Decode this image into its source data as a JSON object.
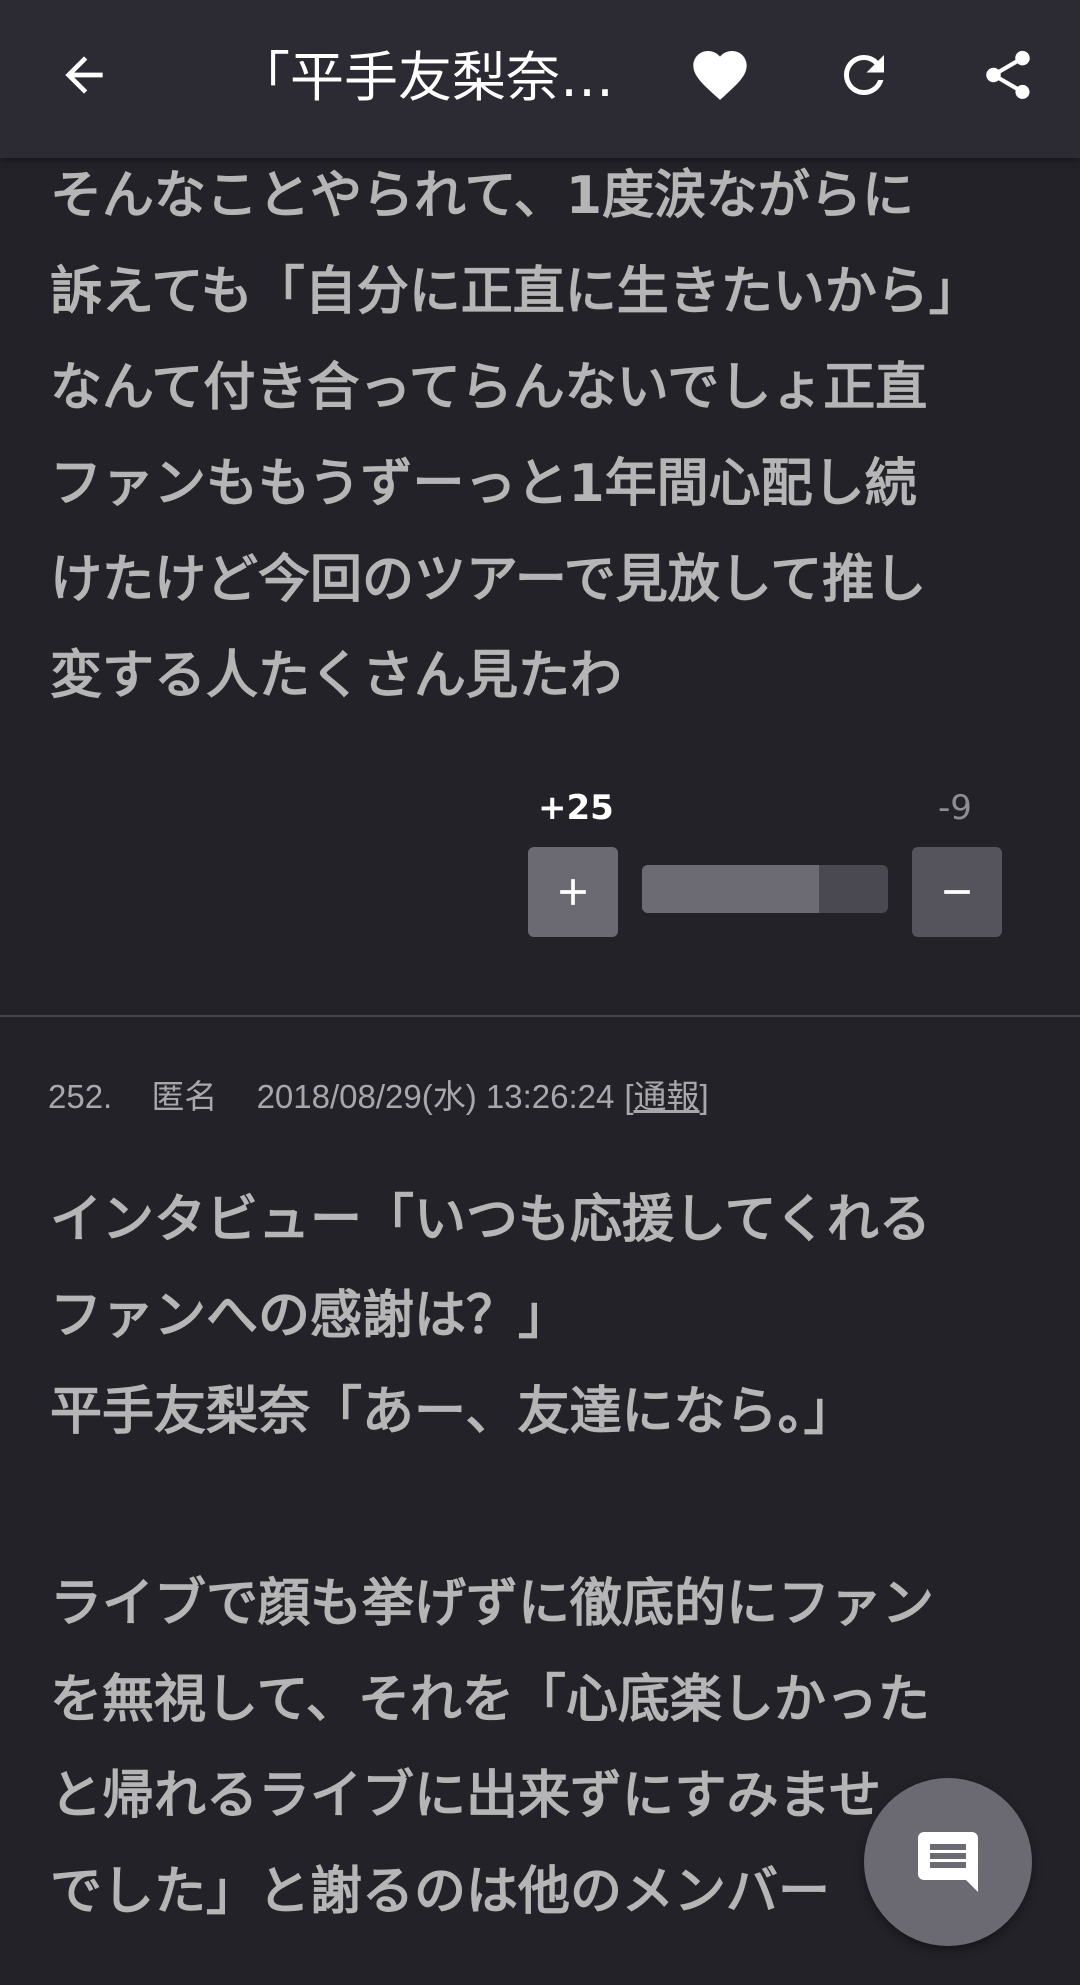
{
  "appbar": {
    "title": "「平手友梨奈…",
    "back_icon": "arrow-left-icon",
    "favorite_icon": "heart-icon",
    "refresh_icon": "refresh-icon",
    "share_icon": "share-icon"
  },
  "comment_prev": {
    "body": "そんなことやられて、1度涙ながらに\n訴えても「自分に正直に生きたいから」\nなんて付き合ってらんないでしょ正直\nファンももうずーっと1年間心配し続\nけたけど今回のツアーで見放して推し\n変する人たくさん見たわ",
    "plus_count": "+25",
    "minus_count": "-9",
    "plus_ratio": 0.72
  },
  "comment_252": {
    "number": "252.",
    "author": "匿名",
    "datetime": "2018/08/29(水) 13:26:24",
    "report_open": "[",
    "report_label": "通報",
    "report_close": "]",
    "body": "インタビュー「いつも応援してくれる\nファンへの感謝は？」\n平手友梨奈「あー、友達になら。」\n\nライブで顔も挙げずに徹底的にファン\nを無視して、それを「心底楽しかった\nと帰れるライブに出来ずにすみませ\nでした」と謝るのは他のメンバー"
  },
  "fab": {
    "icon": "comment-icon"
  },
  "colors": {
    "background": "#232229",
    "appbar": "#2c2b33",
    "plus_count": "#ffffff",
    "minus_count": "#8e8d94"
  }
}
